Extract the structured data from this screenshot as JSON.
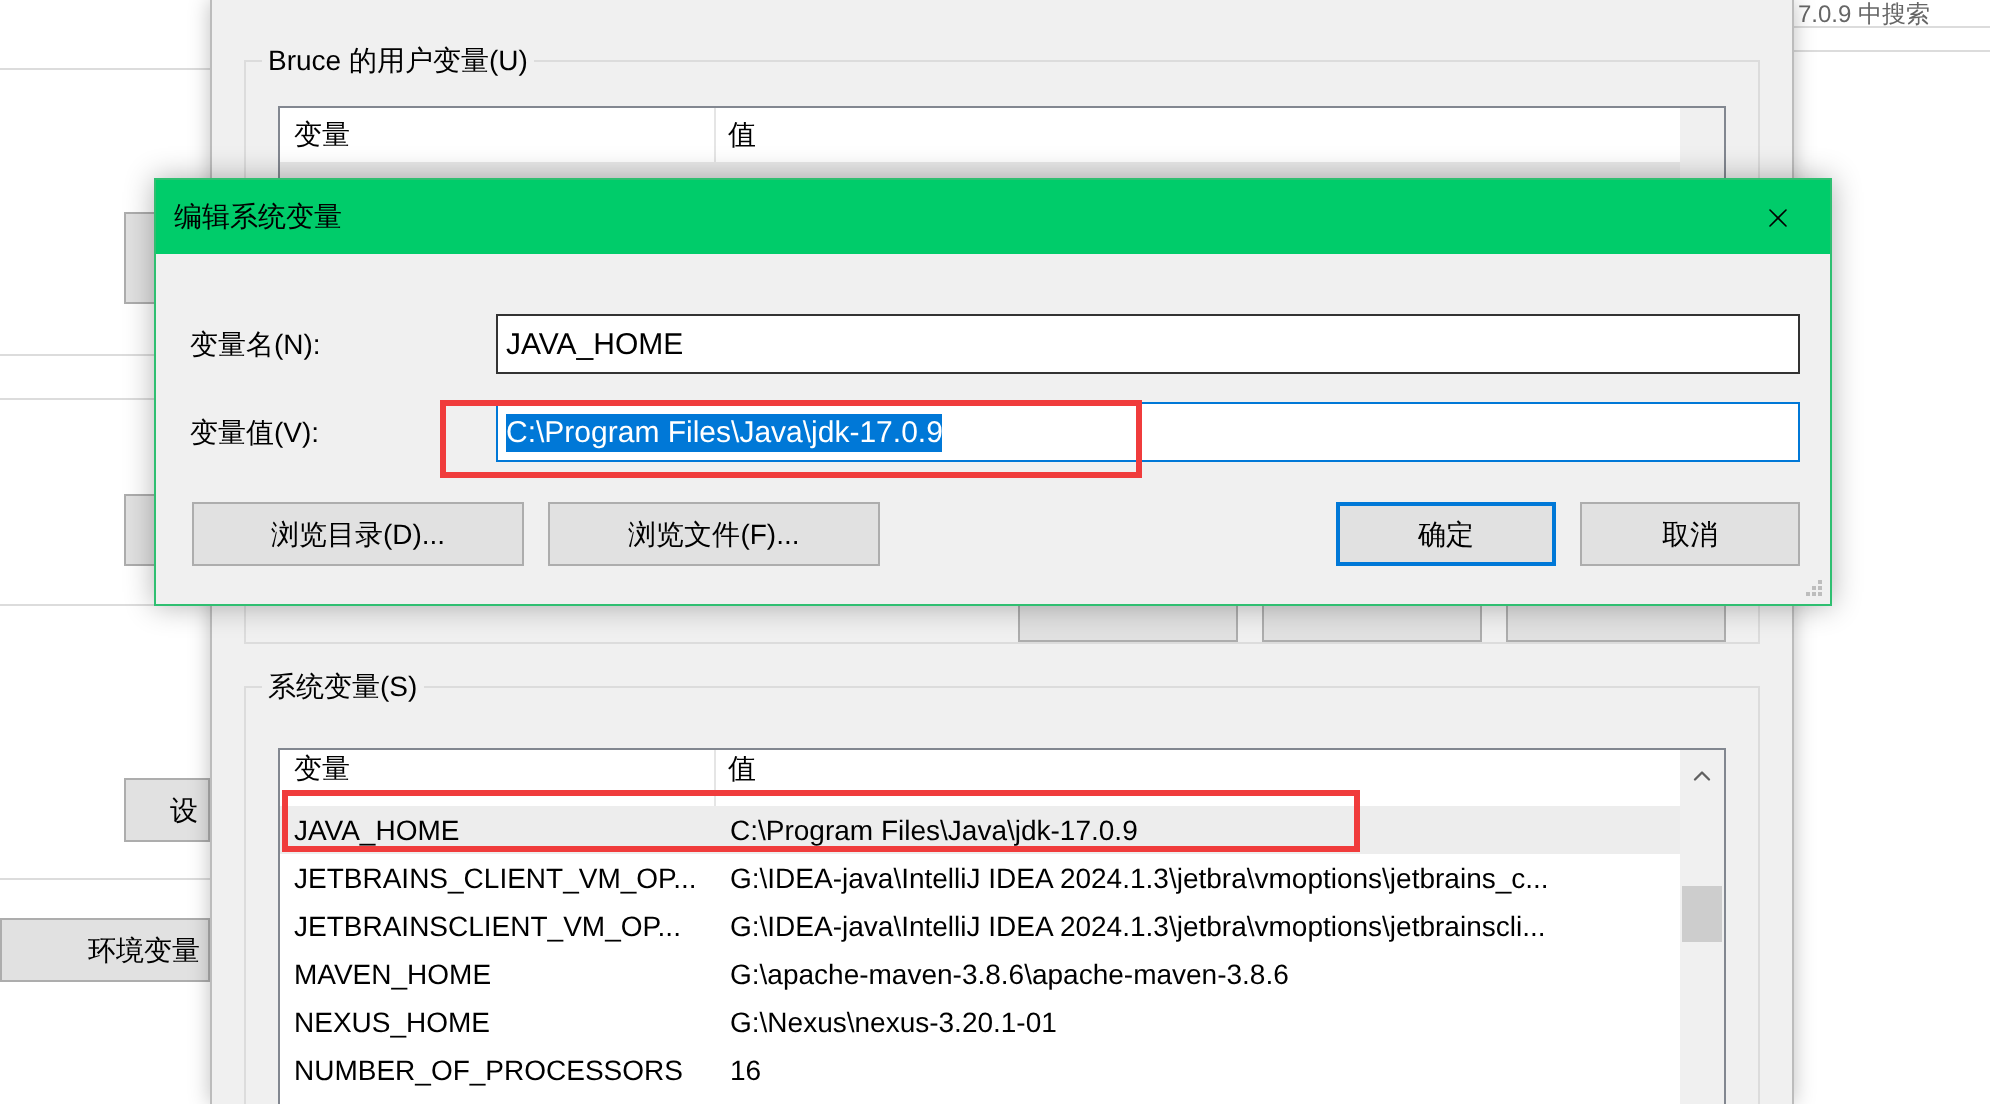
{
  "background_page": {
    "search_link": "7.0.9 中搜索",
    "buttons": [
      {
        "label": "设"
      },
      {
        "label": "环境变量"
      }
    ]
  },
  "env_window": {
    "user_group": {
      "title": "Bruce 的用户变量(U)",
      "columns": [
        "变量",
        "值"
      ]
    },
    "system_group": {
      "title": "系统变量(S)",
      "columns": [
        "变量",
        "值"
      ],
      "rows": [
        {
          "name": "JAVA_HOME",
          "value": "C:\\Program Files\\Java\\jdk-17.0.9",
          "selected": true
        },
        {
          "name": "JETBRAINS_CLIENT_VM_OP...",
          "value": "G:\\IDEA-java\\IntelliJ IDEA 2024.1.3\\jetbra\\vmoptions\\jetbrains_c...",
          "selected": false
        },
        {
          "name": "JETBRAINSCLIENT_VM_OP...",
          "value": "G:\\IDEA-java\\IntelliJ IDEA 2024.1.3\\jetbra\\vmoptions\\jetbrainscli...",
          "selected": false
        },
        {
          "name": "MAVEN_HOME",
          "value": "G:\\apache-maven-3.8.6\\apache-maven-3.8.6",
          "selected": false
        },
        {
          "name": "NEXUS_HOME",
          "value": "G:\\Nexus\\nexus-3.20.1-01",
          "selected": false
        },
        {
          "name": "NUMBER_OF_PROCESSORS",
          "value": "16",
          "selected": false
        }
      ]
    }
  },
  "dialog": {
    "title": "编辑系统变量",
    "fields": [
      {
        "label": "变量名(N):",
        "value": "JAVA_HOME",
        "focused": false,
        "text_selected": false
      },
      {
        "label": "变量值(V):",
        "value": "C:\\Program Files\\Java\\jdk-17.0.9",
        "focused": true,
        "text_selected": true
      }
    ],
    "left_buttons": [
      {
        "label": "浏览目录(D)...",
        "default": false
      },
      {
        "label": "浏览文件(F)...",
        "default": false
      }
    ],
    "right_buttons": [
      {
        "label": "确定",
        "default": true
      },
      {
        "label": "取消",
        "default": false
      }
    ]
  }
}
